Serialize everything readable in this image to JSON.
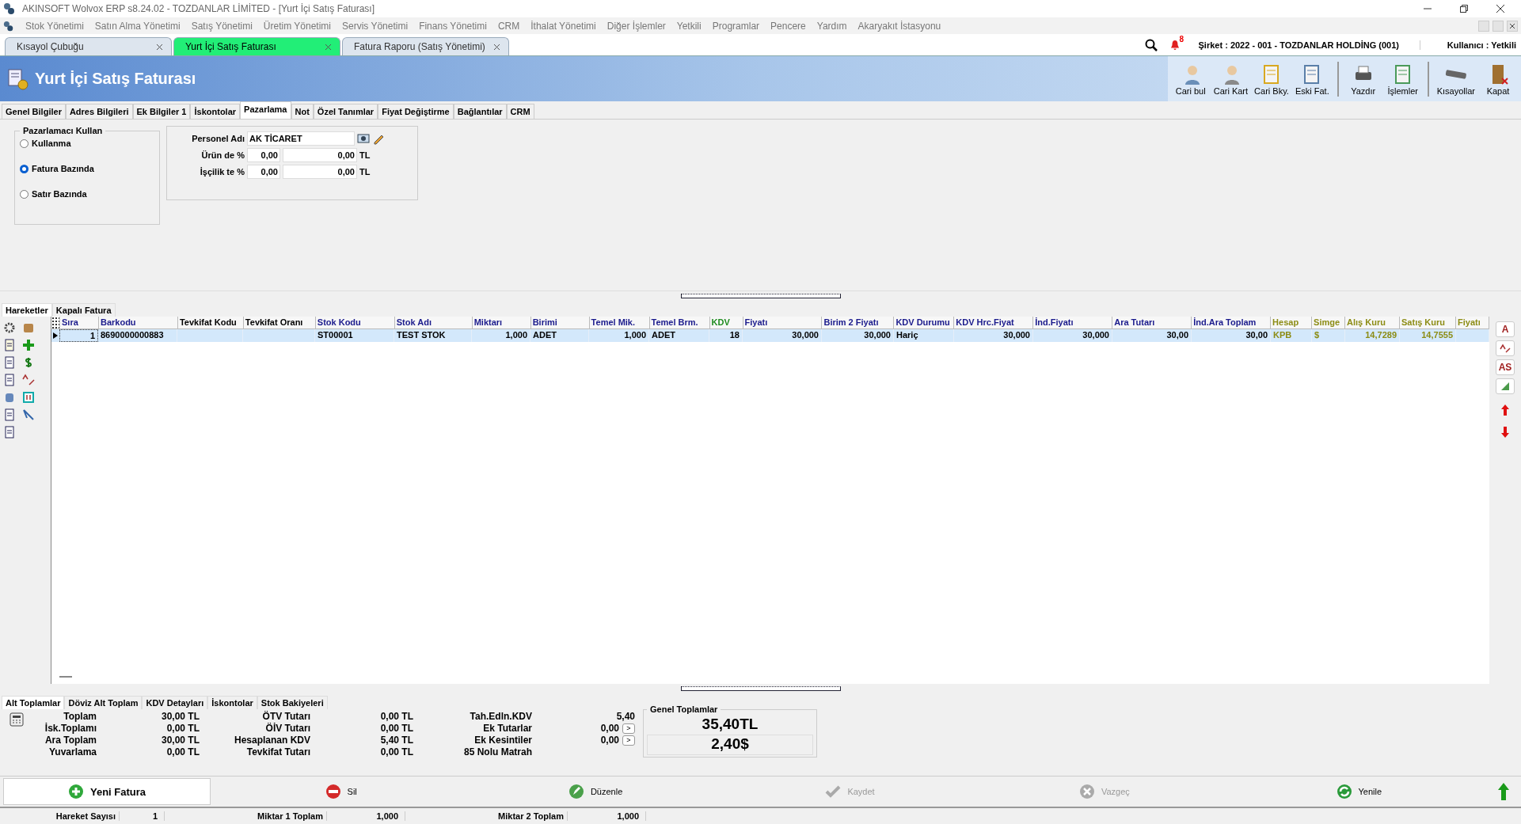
{
  "window": {
    "title": "AKINSOFT Wolvox ERP s8.24.02 - TOZDANLAR LİMİTED - [Yurt İçi Satış Faturası]"
  },
  "menu": [
    "Stok Yönetimi",
    "Satın Alma Yönetimi",
    "Satış Yönetimi",
    "Üretim Yönetimi",
    "Servis Yönetimi",
    "Finans Yönetimi",
    "CRM",
    "İthalat Yönetimi",
    "Diğer İşlemler",
    "Yetkili",
    "Programlar",
    "Pencere",
    "Yardım",
    "Akaryakıt İstasyonu"
  ],
  "doc_tabs": [
    {
      "label": "Kısayol Çubuğu",
      "selected": false
    },
    {
      "label": "Yurt İçi Satış Faturası",
      "selected": true
    },
    {
      "label": "Fatura Raporu (Satış Yönetimi)",
      "selected": false
    }
  ],
  "notifications": "8",
  "company": "Şirket : 2022 - 001 - TOZDANLAR HOLDİNG (001)",
  "user": "Kullanıcı : Yetkili",
  "form_title": "Yurt İçi Satış Faturası",
  "toolbar": [
    {
      "label": "Cari bul",
      "kind": "find"
    },
    {
      "label": "Cari Kart",
      "kind": "card"
    },
    {
      "label": "Cari Bky.",
      "kind": "balance"
    },
    {
      "label": "Eski Fat.",
      "kind": "invoices"
    },
    {
      "label": "Yazdır",
      "kind": "print"
    },
    {
      "label": "İşlemler",
      "kind": "ops"
    },
    {
      "label": "Kısayollar",
      "kind": "keys"
    },
    {
      "label": "Kapat",
      "kind": "close"
    }
  ],
  "form_tabs": [
    {
      "label": "Genel Bilgiler",
      "selected": false
    },
    {
      "label": "Adres Bilgileri",
      "selected": false
    },
    {
      "label": "Ek Bilgiler 1",
      "selected": false
    },
    {
      "label": "İskontolar",
      "selected": false
    },
    {
      "label": "Pazarlama",
      "selected": true
    },
    {
      "label": "Not",
      "selected": false
    },
    {
      "label": "Özel Tanımlar",
      "selected": false
    },
    {
      "label": "Fiyat Değiştirme",
      "selected": false
    },
    {
      "label": "Bağlantılar",
      "selected": false
    },
    {
      "label": "CRM",
      "selected": false
    }
  ],
  "marketing": {
    "group_title": "Pazarlamacı Kullan",
    "options": [
      {
        "label": "Kullanma",
        "selected": false
      },
      {
        "label": "Fatura Bazında",
        "selected": true
      },
      {
        "label": "Satır Bazında",
        "selected": false
      }
    ],
    "personnel_label": "Personel Adı",
    "personnel_value": "AK TİCARET",
    "rates": [
      {
        "label": "Ürün de %",
        "percent": "0,00",
        "amount": "0,00",
        "currency": "TL"
      },
      {
        "label": "İşçilik te %",
        "percent": "0,00",
        "amount": "0,00",
        "currency": "TL"
      }
    ]
  },
  "grid_tabs": [
    {
      "label": "Hareketler",
      "selected": true
    },
    {
      "label": "Kapalı Fatura",
      "selected": false
    }
  ],
  "columns": [
    {
      "label": "Sıra",
      "color": "#1a1a8c",
      "kind": "number"
    },
    {
      "label": "Barkodu",
      "color": "#1a1a8c",
      "kind": "text"
    },
    {
      "label": "Tevkifat Kodu",
      "color": "#000000",
      "kind": "text"
    },
    {
      "label": "Tevkifat Oranı",
      "color": "#000000",
      "kind": "text"
    },
    {
      "label": "Stok Kodu",
      "color": "#1a1a8c",
      "kind": "text"
    },
    {
      "label": "Stok Adı",
      "color": "#1a1a8c",
      "kind": "text"
    },
    {
      "label": "Miktarı",
      "color": "#1a1a8c",
      "kind": "number"
    },
    {
      "label": "Birimi",
      "color": "#1a1a8c",
      "kind": "text"
    },
    {
      "label": "Temel Mik.",
      "color": "#1a1a8c",
      "kind": "number"
    },
    {
      "label": "Temel Brm.",
      "color": "#1a1a8c",
      "kind": "text"
    },
    {
      "label": "KDV",
      "color": "#1f8c1f",
      "kind": "number"
    },
    {
      "label": "Fiyatı",
      "color": "#1a1a8c",
      "kind": "number"
    },
    {
      "label": "Birim 2 Fiyatı",
      "color": "#1a1a8c",
      "kind": "number"
    },
    {
      "label": "KDV Durumu",
      "color": "#1a1a8c",
      "kind": "text"
    },
    {
      "label": "KDV Hrc.Fiyat",
      "color": "#1a1a8c",
      "kind": "number"
    },
    {
      "label": "İnd.Fiyatı",
      "color": "#1a1a8c",
      "kind": "number"
    },
    {
      "label": "Ara Tutarı",
      "color": "#1a1a8c",
      "kind": "number"
    },
    {
      "label": "İnd.Ara Toplam",
      "color": "#1a1a8c",
      "kind": "number"
    },
    {
      "label": "Hesap",
      "color": "#8c8c14",
      "kind": "text"
    },
    {
      "label": "Simge",
      "color": "#8c8c14",
      "kind": "text"
    },
    {
      "label": "Alış Kuru",
      "color": "#8c8c14",
      "kind": "number"
    },
    {
      "label": "Satış Kuru",
      "color": "#8c8c14",
      "kind": "number"
    },
    {
      "label": "Fiyatı",
      "color": "#8c8c14",
      "kind": "number"
    }
  ],
  "rows": [
    {
      "selected": true,
      "cells": [
        "1",
        "8690000000883",
        null,
        null,
        "ST00001",
        "TEST STOK",
        "1,000",
        "ADET",
        "1,000",
        "ADET",
        "18",
        "30,000",
        "30,000",
        "Hariç",
        "30,000",
        "30,000",
        "30,00",
        "30,00",
        "KPB",
        "$",
        "14,7289",
        "14,7555",
        null
      ]
    }
  ],
  "side_tools": [
    "A",
    "AS"
  ],
  "total_tabs": [
    {
      "label": "Alt Toplamlar",
      "selected": true
    },
    {
      "label": "Döviz Alt Toplam",
      "selected": false
    },
    {
      "label": "KDV Detayları",
      "selected": false
    },
    {
      "label": "İskontolar",
      "selected": false
    },
    {
      "label": "Stok Bakiyeleri",
      "selected": false
    }
  ],
  "totals_1": [
    {
      "label": "Toplam",
      "value": "30,00 TL"
    },
    {
      "label": "İsk.Toplamı",
      "value": "0,00 TL"
    },
    {
      "label": "Ara Toplam",
      "value": "30,00 TL"
    },
    {
      "label": "Yuvarlama",
      "value": "0,00 TL"
    }
  ],
  "totals_2": [
    {
      "label": "ÖTV Tutarı",
      "value": "0,00 TL"
    },
    {
      "label": "ÖİV Tutarı",
      "value": "0,00 TL"
    },
    {
      "label": "Hesaplanan KDV",
      "value": "5,40 TL"
    },
    {
      "label": "Tevkifat Tutarı",
      "value": "0,00 TL"
    }
  ],
  "totals_3": [
    {
      "label": "Tah.Edln.KDV",
      "value": "5,40",
      "more": false
    },
    {
      "label": "Ek Tutarlar",
      "value": "0,00",
      "more": true
    },
    {
      "label": "Ek Kesintiler",
      "value": "0,00",
      "more": true
    },
    {
      "label": "85 Nolu Matrah",
      "more": false
    }
  ],
  "more_button": ">",
  "grand_totals": {
    "title": "Genel Toplamlar",
    "tl": "35,40TL",
    "fx": "2,40$"
  },
  "actions": [
    {
      "label": "Yeni Fatura",
      "kind": "new",
      "disabled": false
    },
    {
      "label": "Sil",
      "kind": "delete",
      "disabled": false
    },
    {
      "label": "Düzenle",
      "kind": "edit",
      "disabled": false
    },
    {
      "label": "Kaydet",
      "kind": "save",
      "disabled": true
    },
    {
      "label": "Vazgeç",
      "kind": "cancel",
      "disabled": true
    },
    {
      "label": "Yenile",
      "kind": "refresh",
      "disabled": false
    }
  ],
  "status": [
    {
      "label": "Hareket Sayısı",
      "value": "1"
    },
    {
      "label": "Miktar 1 Toplam",
      "value": "1,000"
    },
    {
      "label": "Miktar 2 Toplam",
      "value": "1,000"
    }
  ]
}
